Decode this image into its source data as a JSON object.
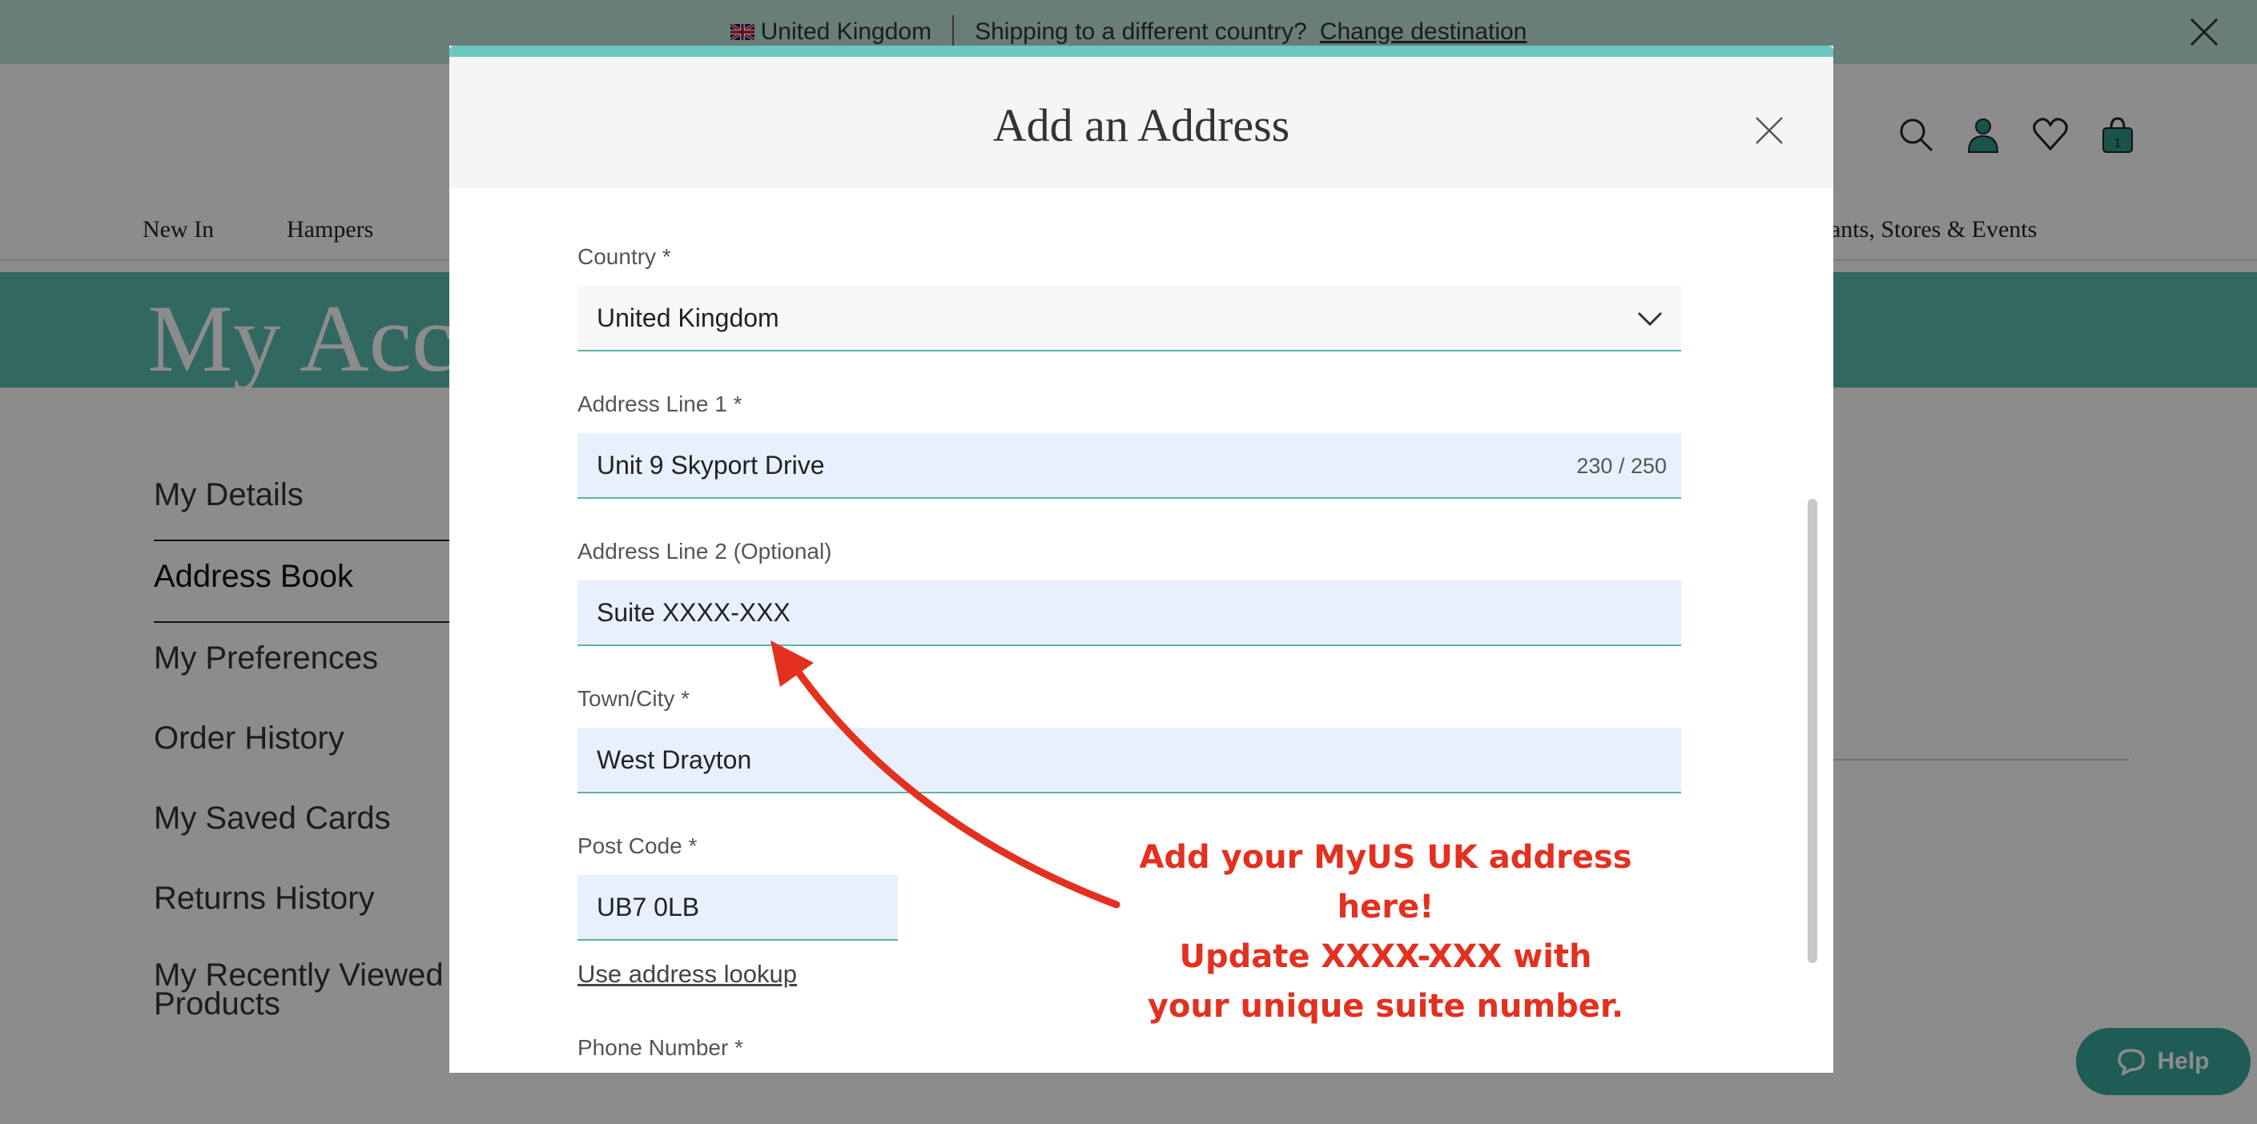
{
  "topbar": {
    "country": "United Kingdom",
    "shipping_text": "Shipping to a different country?",
    "change_link": "Change destination"
  },
  "header": {
    "icons": [
      "search-icon",
      "account-icon",
      "wishlist-icon",
      "bag-icon"
    ],
    "bag_count": "1"
  },
  "nav": {
    "items": [
      "New In",
      "Hampers",
      "urants, Stores & Events"
    ]
  },
  "hero": {
    "title": "My Acco"
  },
  "sidenav": {
    "items": [
      "My Details",
      "Address Book",
      "My Preferences",
      "Order History",
      "My Saved Cards",
      "Returns History",
      "My Recently Viewed",
      "Products"
    ]
  },
  "modal": {
    "title": "Add an Address",
    "country_label": "Country *",
    "country_value": "United Kingdom",
    "address1_label": "Address Line 1 *",
    "address1_value": "Unit 9 Skyport Drive",
    "address1_counter": "230 / 250",
    "address2_label": "Address Line 2 (Optional)",
    "address2_value": "Suite XXXX-XXX",
    "town_label": "Town/City *",
    "town_value": "West Drayton",
    "postcode_label": "Post Code *",
    "postcode_value": "UB7 0LB",
    "lookup_link": "Use address lookup",
    "phone_label": "Phone Number *"
  },
  "annotation": {
    "line1": "Add your MyUS UK address here!",
    "line2": "Update XXXX-XXX with",
    "line3": "your unique suite number.",
    "color": "#e3301f"
  },
  "help": {
    "label": "Help"
  },
  "colors": {
    "teal_accent": "#5cbdb2",
    "input_bg": "#e8f0fe",
    "annotation_red": "#e3301f"
  }
}
